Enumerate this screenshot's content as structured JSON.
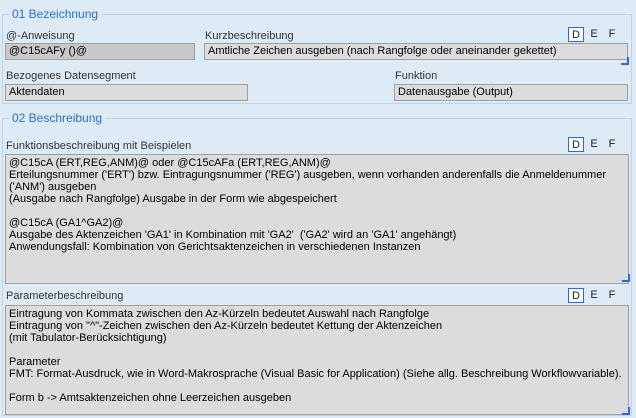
{
  "section1": {
    "title": "01  Bezeichnung",
    "anweisung_label": "@-Anweisung",
    "anweisung_value": "@C15cAFy ()@",
    "kurz_label": "Kurzbeschreibung",
    "kurz_value": "Amtliche Zeichen ausgeben (nach Rangfolge oder aneinander gekettet)",
    "segment_label": "Bezogenes Datensegment",
    "segment_value": "Aktendaten",
    "funktion_label": "Funktion",
    "funktion_value": "Datenausgabe (Output)",
    "lang": [
      "D",
      "E",
      "F"
    ]
  },
  "section2": {
    "title": "02  Beschreibung",
    "func_label": "Funktionsbeschreibung mit Beispielen",
    "func_lines": [
      "@C15cA (ERT,REG,ANM)@ oder @C15cAFa (ERT,REG,ANM)@",
      "Erteilungsnummer ('ERT') bzw. Eintragungsnummer ('REG') ausgeben, wenn vorhanden anderenfalls die Anmeldenummer",
      "('ANM') ausgeben",
      "(Ausgabe nach Rangfolge) Ausgabe in der Form wie abgespeichert",
      "",
      "@C15cA (GA1^GA2)@",
      "Ausgabe des Aktenzeichen 'GA1' in Kombination mit 'GA2'  ('GA2' wird an 'GA1' angehängt)",
      "Anwendungsfall: Kombination von Gerichtsaktenzeichen in verschiedenen Instanzen"
    ],
    "param_label": "Parameterbeschreibung",
    "param_lines": [
      "Eintragung von Kommata zwischen den Az-Kürzeln bedeutet Auswahl nach Rangfolge",
      "Eintragung von \"^\"-Zeichen zwischen den Az-Kürzeln bedeutet Kettung der Aktenzeichen",
      "(mit Tabulator-Berücksichtigung)",
      "",
      "Parameter",
      "FMT: Format-Ausdruck, wie in Word-Makrosprache (Visual Basic for Application) (Siehe allg. Beschreibung Workflowvariable).",
      "",
      "Form b -> Amtsaktenzeichen ohne Leerzeichen ausgeben"
    ],
    "lang": [
      "D",
      "E",
      "F"
    ]
  }
}
